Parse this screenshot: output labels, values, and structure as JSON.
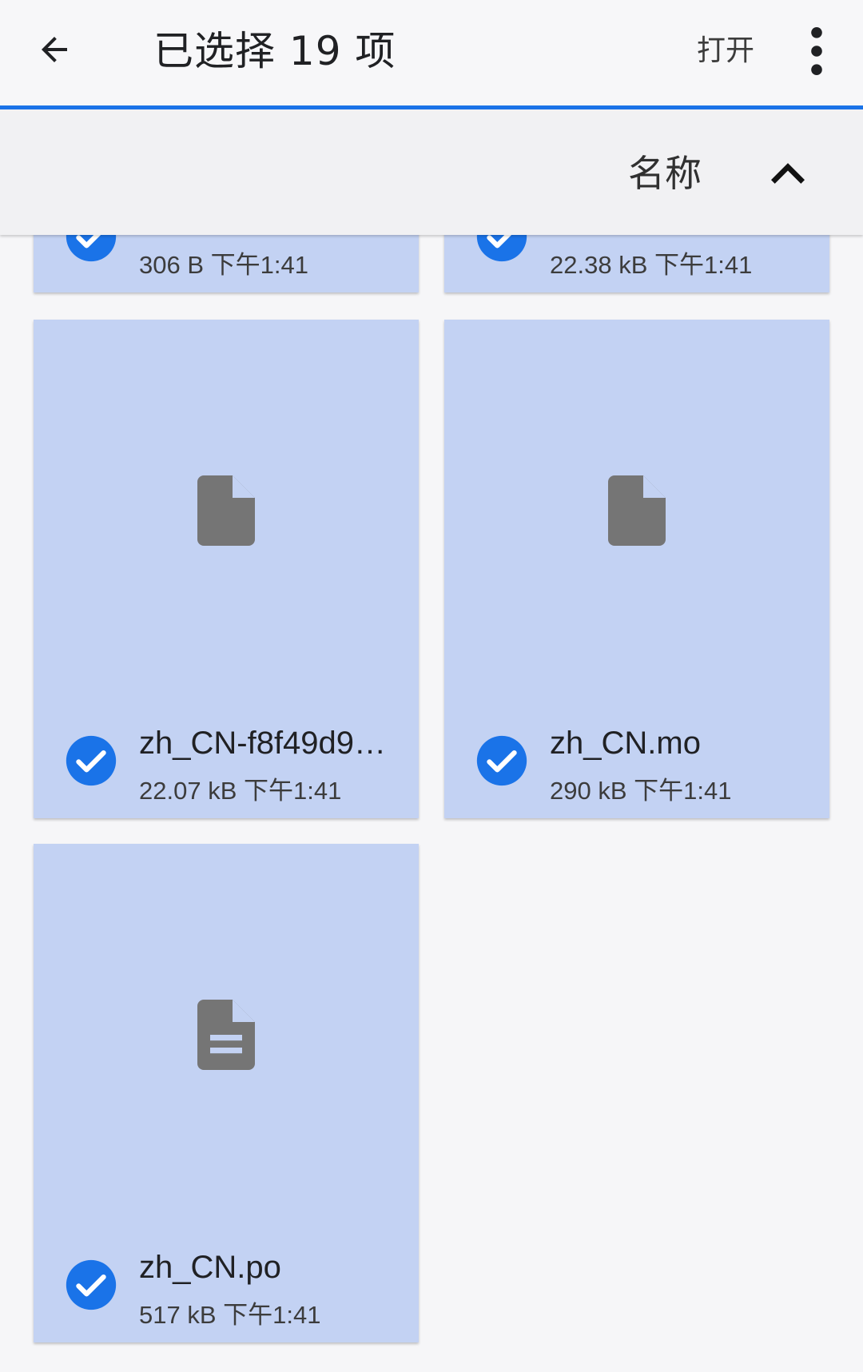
{
  "app_bar": {
    "title": "已选择 19 项",
    "open_label": "打开",
    "back_icon": "arrow-back-icon",
    "more_icon": "more-vert-icon",
    "accent_color": "#1a73e8"
  },
  "sort_bar": {
    "label": "名称",
    "direction_icon": "chevron-up-icon"
  },
  "files": [
    {
      "meta": "306 B 下午1:41",
      "icon": "file-icon",
      "selected": true
    },
    {
      "meta": "22.38 kB 下午1:41",
      "icon": "file-icon",
      "selected": true
    },
    {
      "name": "zh_CN-f8f49d9…",
      "meta": "22.07 kB 下午1:41",
      "icon": "file-icon",
      "selected": true
    },
    {
      "name": "zh_CN.mo",
      "meta": "290 kB 下午1:41",
      "icon": "file-icon",
      "selected": true
    },
    {
      "name": "zh_CN.po",
      "meta": "517 kB 下午1:41",
      "icon": "text-file-icon",
      "selected": true
    }
  ],
  "colors": {
    "card_selected_bg": "#c3d2f3",
    "check_blue": "#1a73e8",
    "icon_gray": "#757575"
  }
}
